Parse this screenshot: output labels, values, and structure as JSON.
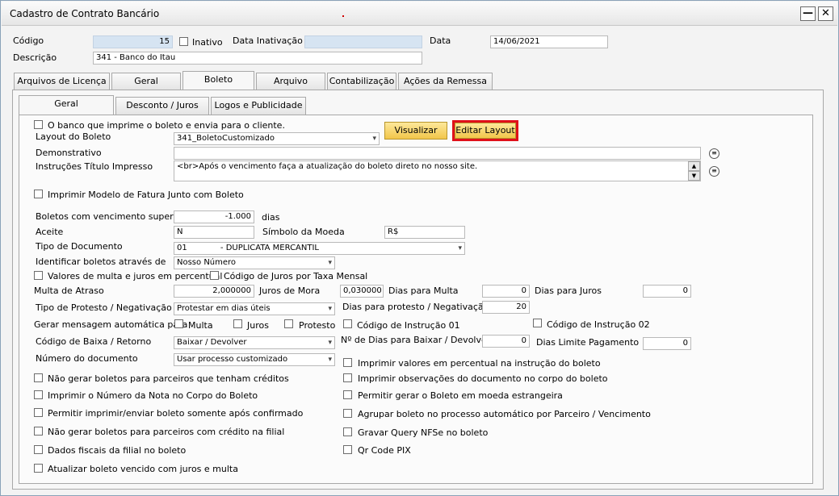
{
  "window": {
    "title": "Cadastro de Contrato Bancário",
    "minimize_icon": "minimize-icon",
    "close_icon": "close-icon"
  },
  "header": {
    "codigo_label": "Código",
    "codigo_value": "15",
    "inativo_label": "Inativo",
    "data_inativacao_label": "Data Inativação",
    "data_inativacao_value": "",
    "data_label": "Data",
    "data_value": "14/06/2021",
    "descricao_label": "Descrição",
    "descricao_value": "341 - Banco do Itau"
  },
  "main_tabs": [
    "Arquivos de Licença",
    "Geral",
    "Boleto",
    "Arquivo",
    "Contabilização",
    "Ações da Remessa"
  ],
  "sub_tabs": [
    "Geral",
    "Desconto / Juros",
    "Logos e Publicidade"
  ],
  "form": {
    "banco_imprime_label": "O banco que imprime o boleto e envia para o cliente.",
    "layout_label": "Layout do Boleto",
    "layout_value": "341_BoletoCustomizado",
    "visualizar_label": "Visualizar",
    "editar_layout_label": "Editar Layout",
    "demonstrativo_label": "Demonstrativo",
    "demonstrativo_value": "",
    "instrucoes_label": "Instruções Título Impresso",
    "instrucoes_value": "<br>Após o vencimento faça a atualização do boleto direto no nosso site.",
    "imprimir_modelo_label": "Imprimir Modelo de Fatura Junto com Boleto",
    "boletos_venc_label": "Boletos com vencimento superior",
    "boletos_venc_value": "-1.000",
    "dias_label": "dias",
    "aceite_label": "Aceite",
    "aceite_value": "N",
    "simbolo_label": "Símbolo da Moeda",
    "simbolo_value": "R$",
    "tipo_doc_label": "Tipo de Documento",
    "tipo_doc_code": "01",
    "tipo_doc_value": "- DUPLICATA MERCANTIL",
    "identificar_label": "Identificar boletos através de",
    "identificar_value": "Nosso Número",
    "valores_percentual_label": "Valores de multa e juros em percentual",
    "codigo_juros_label": "Código de Juros por Taxa Mensal",
    "multa_atraso_label": "Multa de Atraso",
    "multa_atraso_value": "2,000000",
    "juros_mora_label": "Juros de Mora",
    "juros_mora_value": "0,030000",
    "dias_multa_label": "Dias para Multa",
    "dias_multa_value": "0",
    "dias_juros_label": "Dias para Juros",
    "dias_juros_value": "0",
    "tipo_protesto_label": "Tipo de Protesto / Negativação",
    "tipo_protesto_value": "Protestar em dias úteis",
    "dias_protesto_label": "Dias para protesto / Negativação",
    "dias_protesto_value": "20",
    "gerar_msg_label": "Gerar mensagem automática para",
    "multa_chk_label": "Multa",
    "juros_chk_label": "Juros",
    "protesto_chk_label": "Protesto",
    "cod_instr_01_label": "Código de Instrução 01",
    "cod_instr_02_label": "Código de Instrução 02",
    "cod_baixa_label": "Código de Baixa / Retorno",
    "cod_baixa_value": "Baixar / Devolver",
    "n_dias_baixar_label": "Nº de Dias para Baixar / Devolver",
    "n_dias_baixar_value": "0",
    "dias_limite_label": "Dias Limite Pagamento",
    "dias_limite_value": "0",
    "numero_doc_label": "Número do documento",
    "numero_doc_value": "Usar processo customizado"
  },
  "left_checks": [
    "Não gerar boletos para parceiros que tenham créditos",
    "Imprimir o Número da Nota no Corpo do Boleto",
    "Permitir imprimir/enviar boleto somente após confirmado",
    "Não gerar boletos para parceiros com crédito na filial",
    "Dados fiscais da filial no boleto",
    "Atualizar boleto vencido com juros e multa"
  ],
  "right_checks": [
    "Imprimir valores em percentual na instrução do boleto",
    "Imprimir observações do documento no corpo do boleto",
    "Permitir gerar o Boleto em moeda estrangeira",
    "Agrupar boleto no processo automático por Parceiro / Vencimento",
    "Gravar Query NFSe no boleto",
    "Qr Code PIX"
  ],
  "icons": {
    "demonstrativo_icon": "list-icon",
    "instrucoes_icon": "list-icon"
  },
  "colors": {
    "highlight": "#e0101a",
    "button_yellow": "#f2c64a",
    "readonly_field": "#d6e4f2"
  }
}
